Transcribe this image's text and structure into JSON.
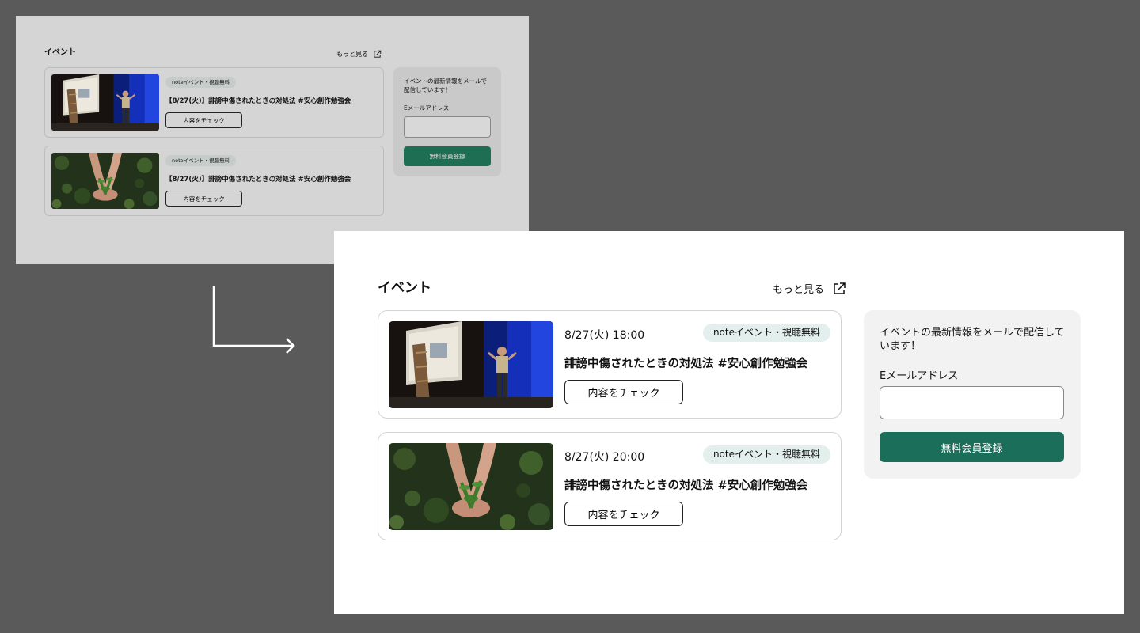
{
  "before": {
    "section_title": "イベント",
    "more_link": "もっと見る",
    "events": [
      {
        "tag": "noteイベント・視聴無料",
        "name": "【8/27(火)】誹謗中傷されたときの対処法 #安心創作勉強会",
        "button": "内容をチェック",
        "image": "speaker-on-stage-photo"
      },
      {
        "tag": "noteイベント・視聴無料",
        "name": "【8/27(火)】誹謗中傷されたときの対処法 #安心創作勉強会",
        "button": "内容をチェック",
        "image": "hands-holding-plant-photo"
      }
    ],
    "sidebar": {
      "text": "イベントの最新情報をメールで配信しています！",
      "email_label": "Eメールアドレス",
      "email_placeholder": "",
      "submit_label": "無料会員登録"
    }
  },
  "after": {
    "section_title": "イベント",
    "more_link": "もっと見る",
    "events": [
      {
        "date": "8/27(火) 18:00",
        "tag": "noteイベント・視聴無料",
        "name": "誹謗中傷されたときの対処法 #安心創作勉強会",
        "button": "内容をチェック",
        "image": "speaker-on-stage-photo"
      },
      {
        "date": "8/27(火) 20:00",
        "tag": "noteイベント・視聴無料",
        "name": "誹謗中傷されたときの対処法 #安心創作勉強会",
        "button": "内容をチェック",
        "image": "hands-holding-plant-photo"
      }
    ],
    "sidebar": {
      "text": "イベントの最新情報をメールで配信しています！",
      "email_label": "Eメールアドレス",
      "email_placeholder": "",
      "submit_label": "無料会員登録"
    }
  },
  "colors": {
    "background": "#5a5a5a",
    "accent_green": "#1a6e5a",
    "tag_background": "#e3efec",
    "sidebar_background": "#f2f2f2"
  }
}
